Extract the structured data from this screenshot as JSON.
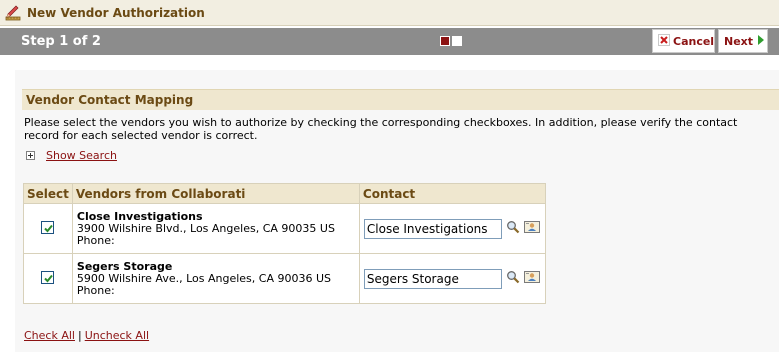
{
  "window": {
    "title": "New Vendor Authorization"
  },
  "stepbar": {
    "step_text": "Step 1 of 2",
    "current_step": 1,
    "total_steps": 2
  },
  "toolbar": {
    "cancel_label": "Cancel",
    "next_label": "Next"
  },
  "section": {
    "title": "Vendor Contact Mapping",
    "instructions": "Please select the vendors you wish to authorize by checking the corresponding checkboxes. In addition, please verify the contact record for each selected vendor is correct.",
    "show_search_label": "Show Search"
  },
  "table": {
    "columns": [
      "Select",
      "Vendors from Collaborati",
      "Contact"
    ],
    "rows": [
      {
        "checked": true,
        "vendor_name": "Close Investigations",
        "address": "3900 Wilshire Blvd., Los Angeles, CA 90035 US",
        "phone_label": "Phone:",
        "contact_value": "Close Investigations"
      },
      {
        "checked": true,
        "vendor_name": "Segers Storage",
        "address": "5900 Wilshire Ave., Los Angeles, CA 90036 US",
        "phone_label": "Phone:",
        "contact_value": "Segers Storage"
      }
    ]
  },
  "footer": {
    "check_all_label": "Check All",
    "separator": "|",
    "uncheck_all_label": "Uncheck All"
  },
  "icons": {
    "title": "pencil-ruler-icon",
    "cancel": "cancel-x-icon",
    "next": "arrow-right-icon",
    "search": "magnifier-icon",
    "contact_card": "contact-card-icon",
    "checkbox": "checkmark-icon"
  },
  "colors": {
    "accent": "#8b1212",
    "header_text": "#6b4a14",
    "header_bg": "#efe7cf",
    "stepbar_bg": "#8c8c8c",
    "next_arrow": "#2f9e2f"
  }
}
